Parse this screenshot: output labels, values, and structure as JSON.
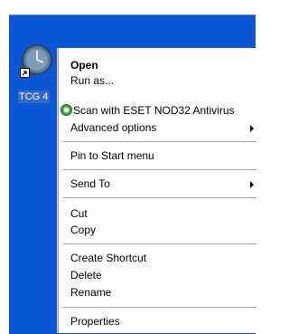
{
  "desktop": {
    "icon_label": "TCG 4",
    "icon_name": "clock-icon",
    "shortcut_name": "shortcut-arrow-icon"
  },
  "context_menu": {
    "items": [
      {
        "label": "Open"
      },
      {
        "label": "Run as..."
      },
      {
        "label": "Scan with ESET NOD32 Antivirus"
      },
      {
        "label": "Advanced options"
      },
      {
        "label": "Pin to Start menu"
      },
      {
        "label": "Send To"
      },
      {
        "label": "Cut"
      },
      {
        "label": "Copy"
      },
      {
        "label": "Create Shortcut"
      },
      {
        "label": "Delete"
      },
      {
        "label": "Rename"
      },
      {
        "label": "Properties"
      }
    ]
  },
  "colors": {
    "desktop": "#0a56d6",
    "selection": "#316ac5",
    "eset_green": "#3aa83a"
  }
}
